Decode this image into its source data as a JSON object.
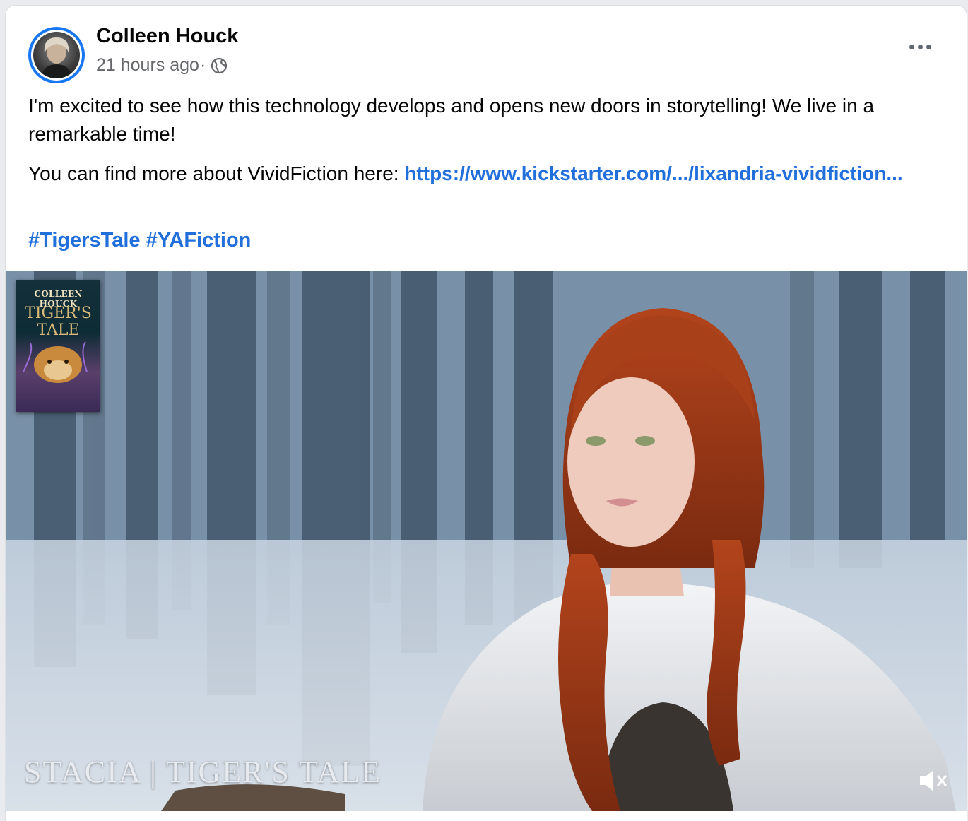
{
  "post": {
    "author": "Colleen Houck",
    "timestamp": "21 hours ago",
    "separator": "·",
    "privacy_icon": "globe-icon",
    "more_icon": "more-horizontal-icon",
    "paragraph1": "I'm excited to see how this technology develops and opens new doors in storytelling! We live in a remarkable time!",
    "paragraph2_prefix": "You can find more about VividFiction here: ",
    "link_text": "https://www.kickstarter.com/.../lixandria-vividfiction...",
    "hashtags": [
      "#TigersTale",
      "#YAFiction"
    ]
  },
  "video": {
    "cover_author": "COLLEEN HOUCK",
    "cover_title": "TIGER'S\nTALE",
    "caption": "STACIA | TIGER'S TALE",
    "mute_icon": "volume-muted-icon"
  },
  "colors": {
    "link": "#216fdb",
    "avatar_ring": "#1877f2",
    "secondary_text": "#65676b"
  }
}
